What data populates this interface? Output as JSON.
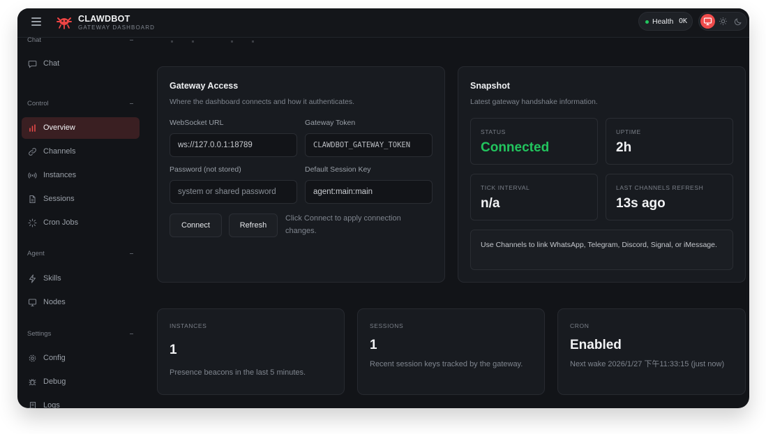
{
  "brand": {
    "title": "CLAWDBOT",
    "subtitle": "GATEWAY DASHBOARD"
  },
  "health": {
    "label": "Health",
    "value": "OK",
    "color": "#22c55e"
  },
  "theme": {
    "accent": "#ef4b4b",
    "options": [
      "monitor-icon",
      "sun-icon",
      "moon-icon"
    ]
  },
  "sidebar": {
    "sections": [
      {
        "label": "Chat",
        "items": [
          {
            "label": "Chat",
            "icon": "chat-bubble-icon"
          }
        ]
      },
      {
        "label": "Control",
        "items": [
          {
            "label": "Overview",
            "icon": "bar-chart-icon",
            "active": true
          },
          {
            "label": "Channels",
            "icon": "link-icon"
          },
          {
            "label": "Instances",
            "icon": "radio-signal-icon"
          },
          {
            "label": "Sessions",
            "icon": "document-icon"
          },
          {
            "label": "Cron Jobs",
            "icon": "loader-icon"
          }
        ]
      },
      {
        "label": "Agent",
        "items": [
          {
            "label": "Skills",
            "icon": "lightning-icon"
          },
          {
            "label": "Nodes",
            "icon": "monitor-icon"
          }
        ]
      },
      {
        "label": "Settings",
        "items": [
          {
            "label": "Config",
            "icon": "gear-icon"
          },
          {
            "label": "Debug",
            "icon": "bug-icon"
          },
          {
            "label": "Logs",
            "icon": "scroll-icon"
          }
        ]
      }
    ]
  },
  "gateway_access": {
    "title": "Gateway Access",
    "subtitle": "Where the dashboard connects and how it authenticates.",
    "websocket_label": "WebSocket URL",
    "websocket_value": "ws://127.0.0.1:18789",
    "token_label": "Gateway Token",
    "token_value": "CLAWDBOT_GATEWAY_TOKEN",
    "password_label": "Password (not stored)",
    "password_placeholder": "system or shared password",
    "session_label": "Default Session Key",
    "session_value": "agent:main:main",
    "connect_label": "Connect",
    "refresh_label": "Refresh",
    "hint": "Click Connect to apply connection changes."
  },
  "snapshot": {
    "title": "Snapshot",
    "subtitle": "Latest gateway handshake information.",
    "status_label": "STATUS",
    "status_value": "Connected",
    "uptime_label": "UPTIME",
    "uptime_value": "2h",
    "tick_label": "TICK INTERVAL",
    "tick_value": "n/a",
    "refresh_label": "LAST CHANNELS REFRESH",
    "refresh_value": "13s ago",
    "note": "Use Channels to link WhatsApp, Telegram, Discord, Signal, or iMessage."
  },
  "summary": {
    "instances": {
      "label": "INSTANCES",
      "value": "1",
      "desc": "Presence beacons in the last 5 minutes."
    },
    "sessions": {
      "label": "SESSIONS",
      "value": "1",
      "desc": "Recent session keys tracked by the gateway."
    },
    "cron": {
      "label": "CRON",
      "value": "Enabled",
      "desc": "Next wake 2026/1/27 下午11:33:15 (just now)"
    }
  }
}
